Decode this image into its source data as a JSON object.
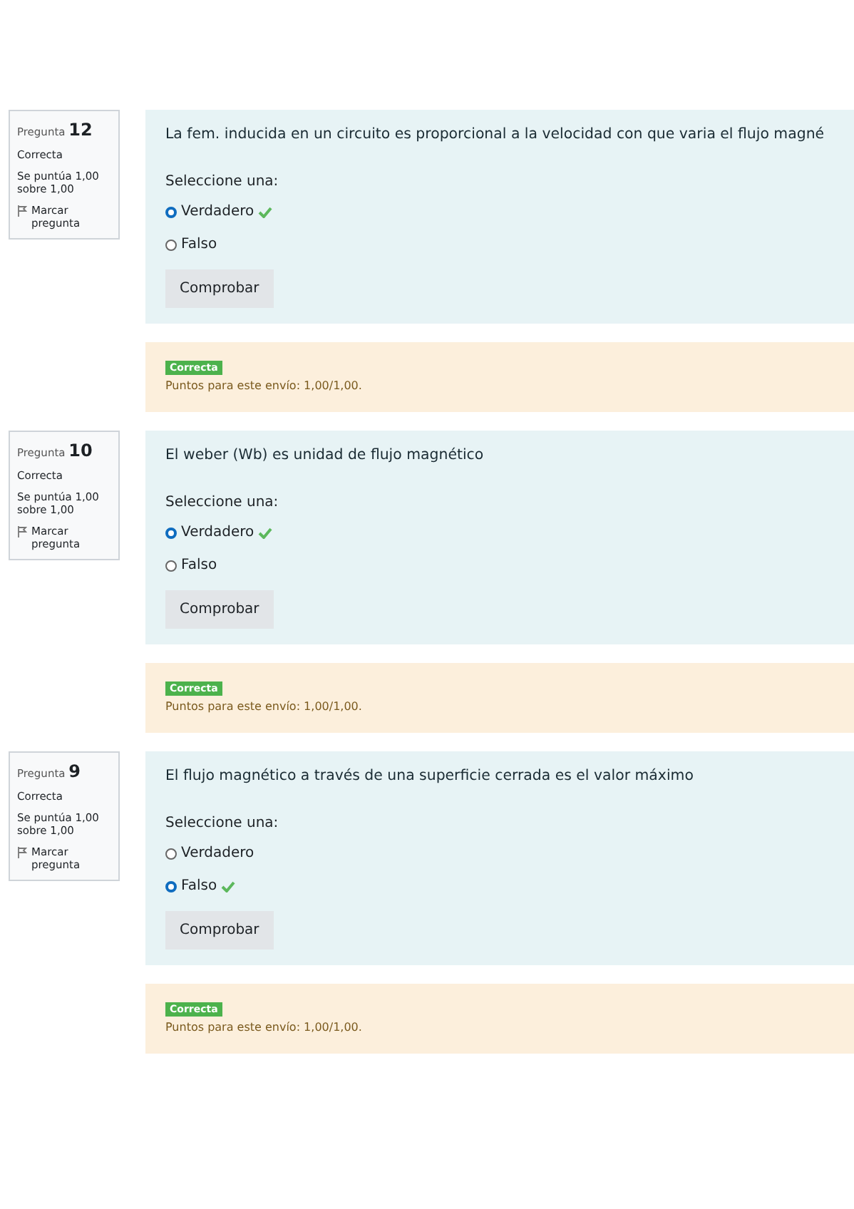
{
  "questions": [
    {
      "label": "Pregunta",
      "number": "12",
      "state": "Correcta",
      "grade": "Se puntúa 1,00 sobre 1,00",
      "flag": "Marcar pregunta",
      "text": "La fem. inducida en un circuito es proporcional  a la velocidad con que varia el flujo magné",
      "prompt": "Seleccione una:",
      "options": [
        {
          "label": "Verdadero",
          "selected": true,
          "correct": true
        },
        {
          "label": "Falso",
          "selected": false,
          "correct": false
        }
      ],
      "button": "Comprobar",
      "badge": "Correcta",
      "feedback": "Puntos para este envío: 1,00/1,00."
    },
    {
      "label": "Pregunta",
      "number": "10",
      "state": "Correcta",
      "grade": "Se puntúa 1,00 sobre 1,00",
      "flag": "Marcar pregunta",
      "text": "El weber (Wb) es unidad de flujo magnético",
      "prompt": "Seleccione una:",
      "options": [
        {
          "label": "Verdadero",
          "selected": true,
          "correct": true
        },
        {
          "label": "Falso",
          "selected": false,
          "correct": false
        }
      ],
      "button": "Comprobar",
      "badge": "Correcta",
      "feedback": "Puntos para este envío: 1,00/1,00."
    },
    {
      "label": "Pregunta",
      "number": "9",
      "state": "Correcta",
      "grade": "Se puntúa 1,00 sobre 1,00",
      "flag": "Marcar pregunta",
      "text": "El flujo magnético a través de una superficie cerrada es el valor máximo",
      "prompt": "Seleccione una:",
      "options": [
        {
          "label": "Verdadero",
          "selected": false,
          "correct": false
        },
        {
          "label": "Falso",
          "selected": true,
          "correct": true
        }
      ],
      "button": "Comprobar",
      "badge": "Correcta",
      "feedback": "Puntos para este envío: 1,00/1,00."
    }
  ]
}
